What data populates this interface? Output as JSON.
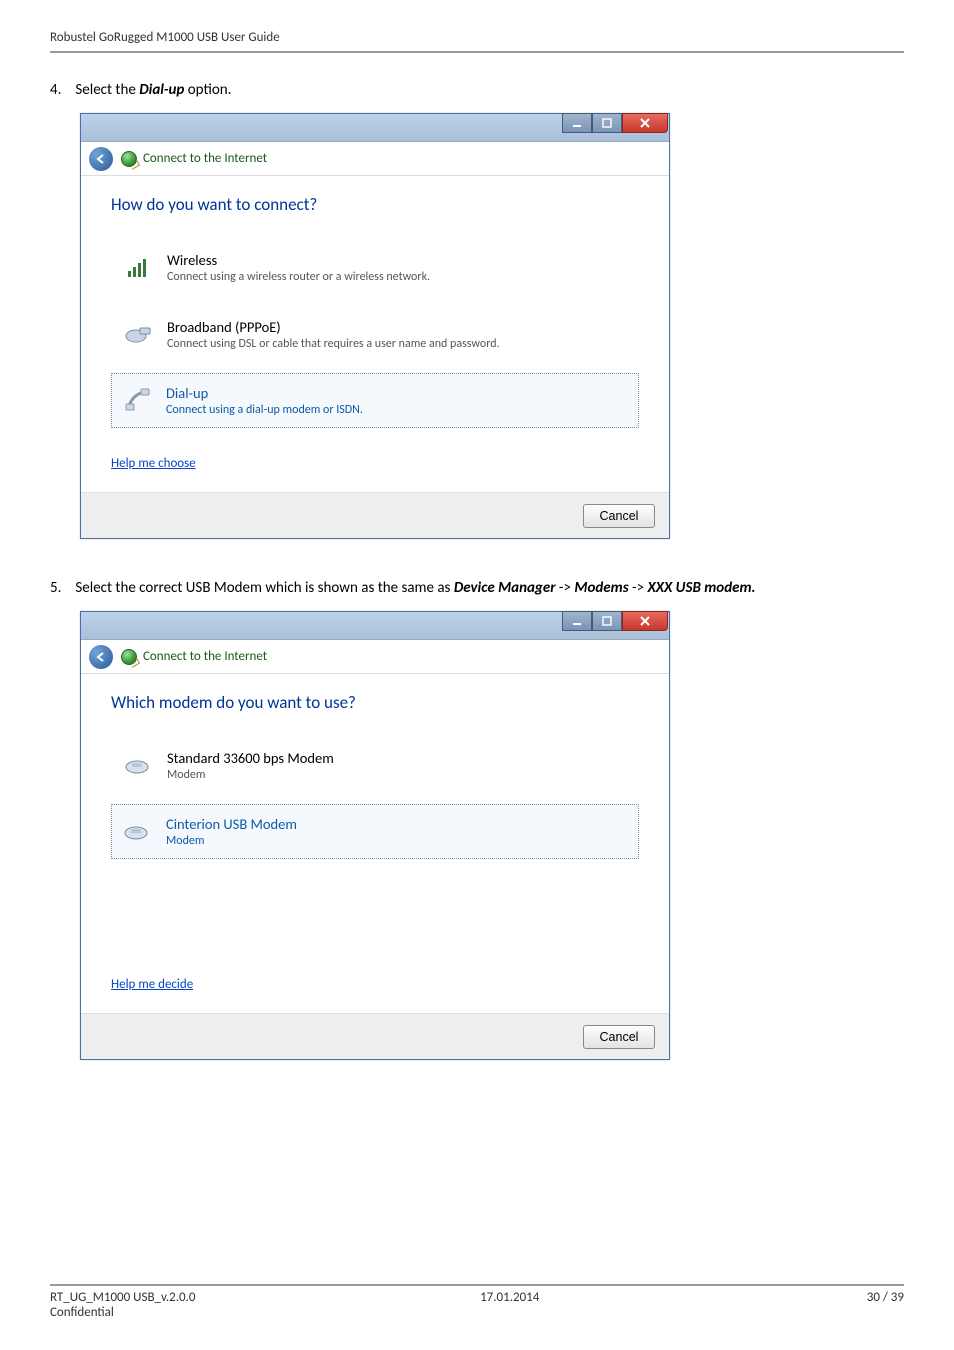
{
  "header": "Robustel GoRugged M1000 USB User Guide",
  "step4": {
    "num": "4.",
    "prefix": "Select the ",
    "bold": "Dial-up",
    "suffix": " option."
  },
  "dialog1": {
    "crumb": "Connect to the Internet",
    "heading": "How do you want to connect?",
    "options": [
      {
        "title": "Wireless",
        "sub": "Connect using a wireless router or a wireless network."
      },
      {
        "title": "Broadband (PPPoE)",
        "sub": "Connect using DSL or cable that requires a user name and password."
      },
      {
        "title": "Dial-up",
        "sub": "Connect using a dial-up modem or ISDN."
      }
    ],
    "help": "Help me choose",
    "cancel": "Cancel"
  },
  "step5": {
    "num": "5.",
    "prefix": "Select the correct USB Modem which is shown as the same as ",
    "b1": "Device Manager",
    "arrow1": " -> ",
    "b2": "Modems",
    "arrow2": " -> ",
    "b3": "XXX USB modem."
  },
  "dialog2": {
    "crumb": "Connect to the Internet",
    "heading": "Which modem do you want to use?",
    "options": [
      {
        "title": "Standard 33600 bps Modem",
        "sub": "Modem"
      },
      {
        "title": "Cinterion USB Modem",
        "sub": "Modem"
      }
    ],
    "help": "Help me decide",
    "cancel": "Cancel"
  },
  "footer": {
    "left1": "RT_UG_M1000 USB_v.2.0.0",
    "left2": "Confidential",
    "center": "17.01.2014",
    "right": "30 / 39"
  }
}
